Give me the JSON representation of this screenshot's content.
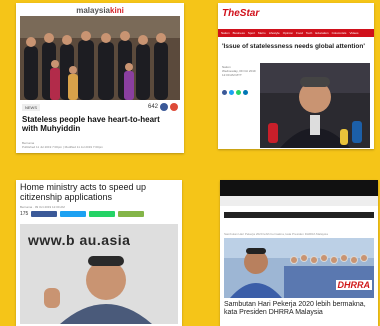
{
  "card1": {
    "logo_pre": "malaysia",
    "logo_post": "kini",
    "tag": "NEWS",
    "share_count": "642",
    "headline": "Stateless people have heart-to-heart with Muhyiddin",
    "byline1": "Bernama",
    "byline2": "Published 11 Jul 2019 7:00pm | Modified 11 Jul 2019 7:00pm"
  },
  "card2": {
    "logo": "TheStar",
    "nav": [
      "Nation",
      "Business",
      "Sport",
      "Metro",
      "Lifestyle",
      "Opinion",
      "Food",
      "Tech",
      "Education",
      "Columnists",
      "Videos"
    ],
    "headline": "'Issue of statelessness needs global attention'",
    "meta1": "Nation",
    "meta2": "Wednesday, 09 Oct 2019",
    "meta3": "12:00 AM MYT"
  },
  "card3": {
    "headline": "Home ministry acts to speed up citizenship applications",
    "meta": "Bernama · 09 Oct 2019 12:00 AM",
    "share_count": "175",
    "url": "www.b        au.asia"
  },
  "card4": {
    "crumb": "Sambutan Hari Pekerja 2020 lebih bermakna, kata Presiden DHRRA Malaysia",
    "logo": "DHRRA",
    "headline": "Sambutan Hari Pekerja 2020 lebih bermakna, kata Presiden DHRRA Malaysia"
  },
  "colors": {
    "background": "#f5c518",
    "star_red": "#d0101b",
    "kini_red": "#d4242b",
    "facebook": "#3b5998",
    "twitter": "#1da1f2",
    "whatsapp": "#25d366"
  }
}
